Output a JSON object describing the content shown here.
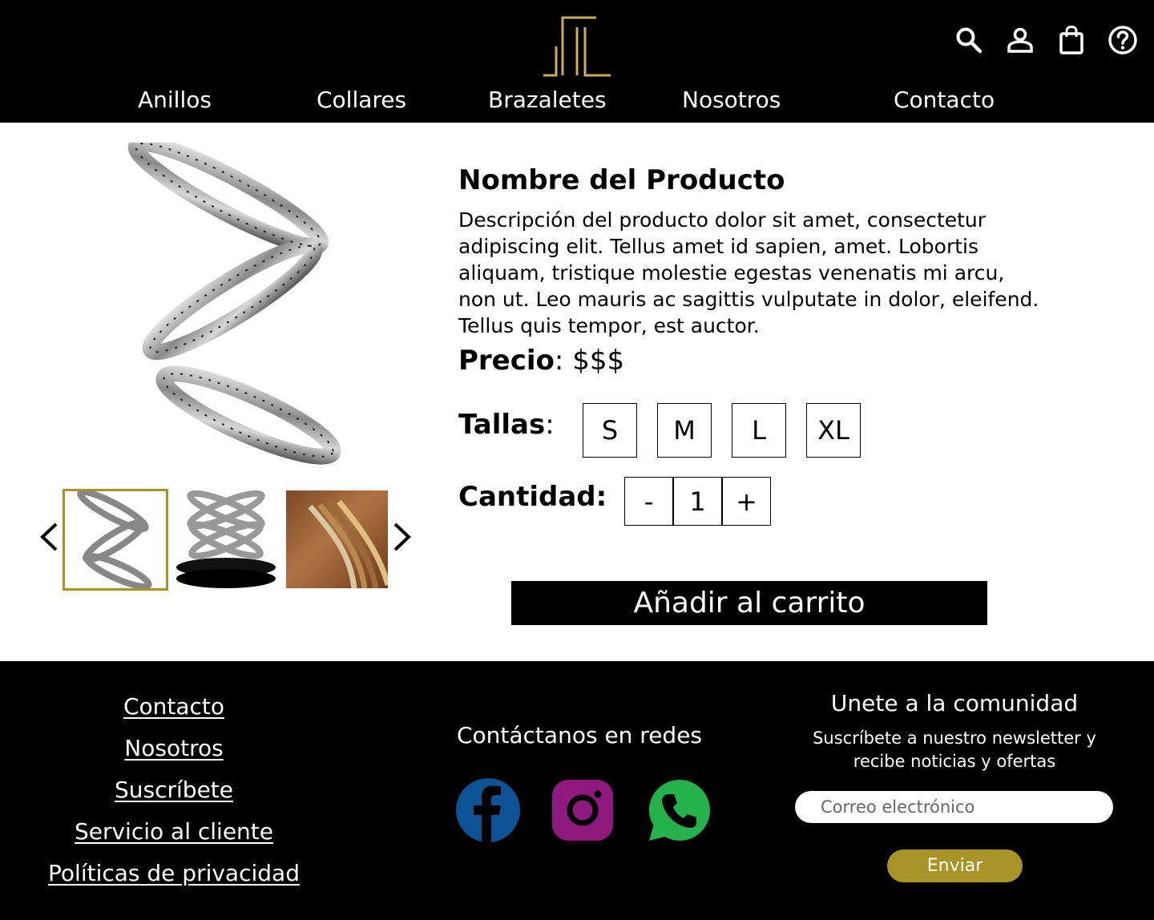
{
  "header": {
    "nav": [
      {
        "label": "Anillos"
      },
      {
        "label": "Collares"
      },
      {
        "label": "Brazaletes"
      },
      {
        "label": "Nosotros"
      },
      {
        "label": "Contacto"
      }
    ],
    "icons": [
      "search-icon",
      "user-icon",
      "shopping-bag-icon",
      "help-icon"
    ]
  },
  "product": {
    "name": "Nombre del Producto",
    "description": "Descripción del producto dolor sit amet, consectetur adipiscing elit. Tellus amet id sapien, amet. Lobortis aliquam, tristique molestie egestas venenatis mi arcu, non ut. Leo mauris ac sagittis vulputate in dolor, eleifend. Tellus quis tempor, est auctor.",
    "price_label": "Precio",
    "price_sep": ": ",
    "price_value": "$$$",
    "sizes_label": "Tallas",
    "sizes_sep": ":",
    "sizes": [
      "S",
      "M",
      "L",
      "XL"
    ],
    "qty_label": "Cantidad:",
    "qty_minus": "-",
    "qty_value": "1",
    "qty_plus": "+",
    "add_to_cart": "Añadir al carrito"
  },
  "footer": {
    "links": [
      {
        "label": "Contacto"
      },
      {
        "label": "Nosotros"
      },
      {
        "label": "Suscríbete"
      },
      {
        "label": "Servicio al cliente"
      },
      {
        "label": "Políticas de privacidad"
      }
    ],
    "social_title": "Contáctanos en redes",
    "social": [
      {
        "icon": "facebook-icon",
        "color": "#0b5394"
      },
      {
        "icon": "instagram-icon",
        "color": "#8e1a7d"
      },
      {
        "icon": "whatsapp-icon",
        "color": "#26b24b"
      }
    ],
    "newsletter_title": "Unete a la comunidad",
    "newsletter_sub": "Suscríbete a nuestro newsletter y recibe noticias y ofertas",
    "email_placeholder": "Correo electrónico",
    "submit": "Enviar"
  },
  "colors": {
    "gold": "#a89426",
    "logo_gold": "#c9ab5a",
    "black": "#000000"
  }
}
